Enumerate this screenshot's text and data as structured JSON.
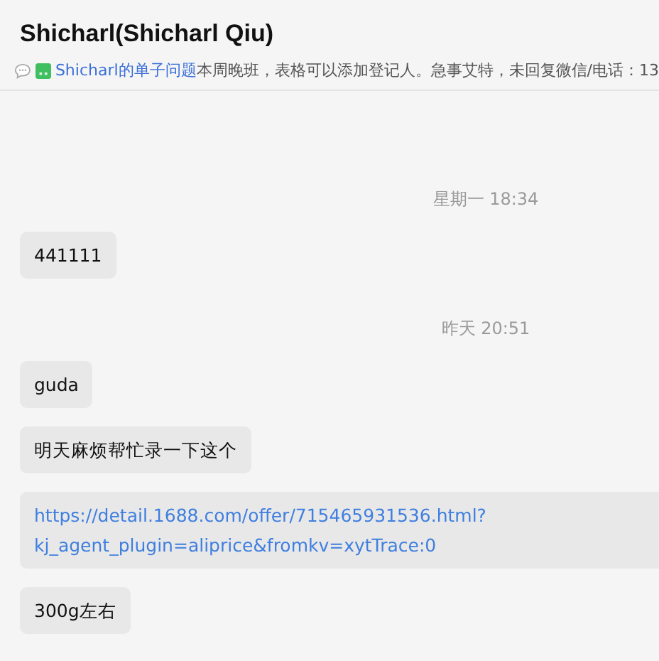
{
  "header": {
    "title": "Shicharl(Shicharl Qiu)",
    "notice": {
      "link": "Shicharl的单子问题",
      "text": "本周晚班，表格可以添加登记人。急事艾特，未回复微信/电话：13"
    }
  },
  "messages": [
    {
      "kind": "time",
      "text": "星期一 18:34"
    },
    {
      "kind": "text",
      "text": "441111"
    },
    {
      "kind": "time",
      "text": "昨天 20:51"
    },
    {
      "kind": "text",
      "text": "guda"
    },
    {
      "kind": "text",
      "text": "明天麻烦帮忙录一下这个"
    },
    {
      "kind": "link",
      "lines": [
        "https://detail.1688.com/offer/715465931536.html?",
        "kj_agent_plugin=aliprice&fromkv=xytTrace:0"
      ]
    },
    {
      "kind": "text",
      "text": "300g左右"
    }
  ]
}
